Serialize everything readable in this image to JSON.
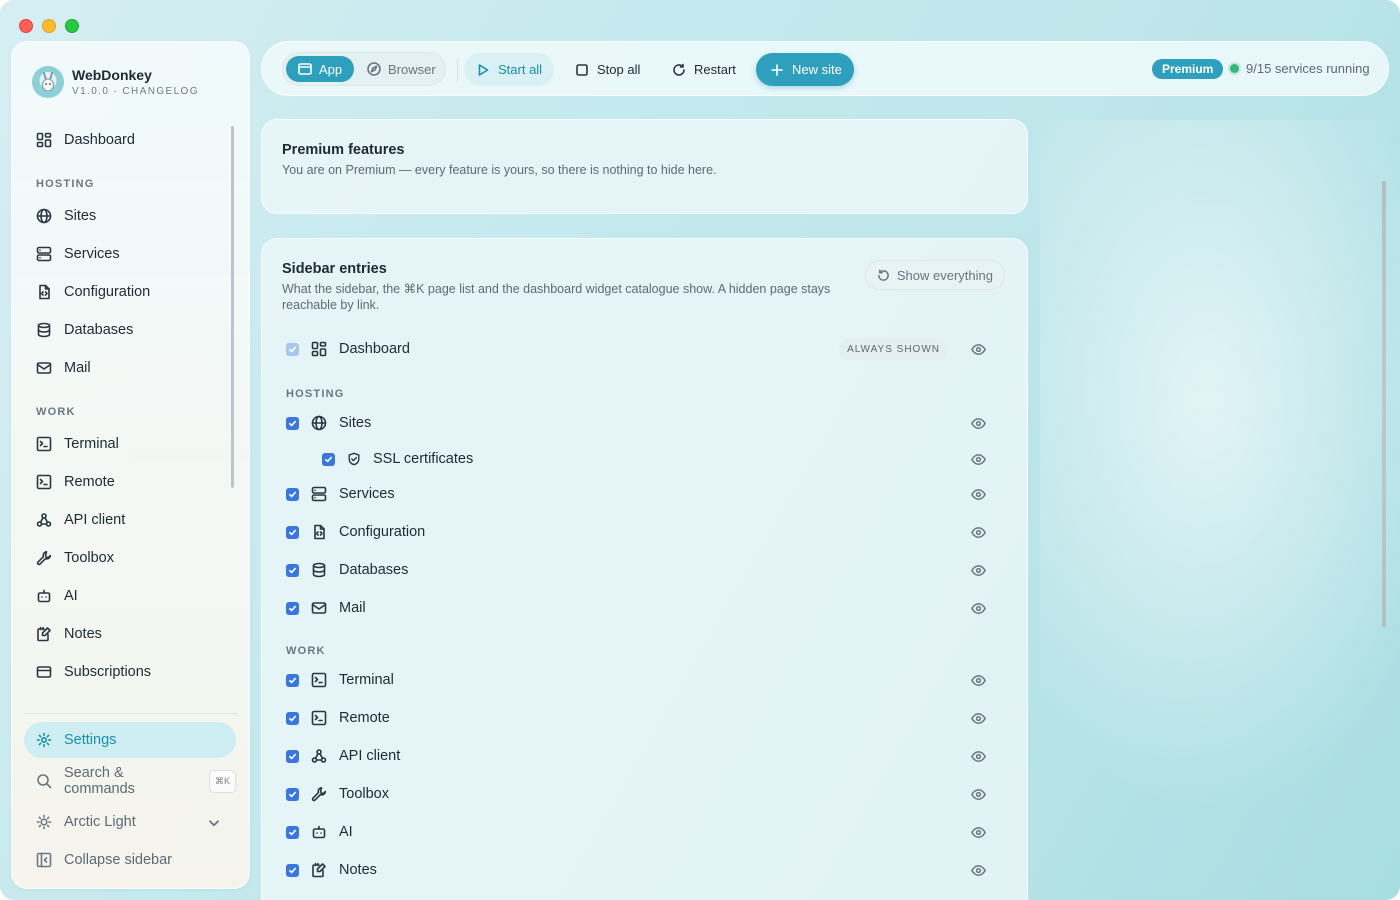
{
  "window": {
    "traffic_lights": [
      "close",
      "minimize",
      "zoom"
    ]
  },
  "brand": {
    "name": "WebDonkey",
    "subtitle": "V1.0.0 · CHANGELOG",
    "avatar_icon": "donkey-avatar-icon"
  },
  "sidebar": {
    "dashboard": {
      "label": "Dashboard",
      "icon": "dashboard-icon"
    },
    "sections": [
      {
        "label": "HOSTING",
        "items": [
          {
            "label": "Sites",
            "icon": "globe-icon"
          },
          {
            "label": "Services",
            "icon": "server-icon"
          },
          {
            "label": "Configuration",
            "icon": "config-file-icon"
          },
          {
            "label": "Databases",
            "icon": "database-icon"
          },
          {
            "label": "Mail",
            "icon": "mail-icon"
          }
        ]
      },
      {
        "label": "WORK",
        "items": [
          {
            "label": "Terminal",
            "icon": "terminal-icon"
          },
          {
            "label": "Remote",
            "icon": "remote-terminal-icon"
          },
          {
            "label": "API client",
            "icon": "webhook-icon"
          },
          {
            "label": "Toolbox",
            "icon": "wrench-icon"
          },
          {
            "label": "AI",
            "icon": "bot-icon"
          },
          {
            "label": "Notes",
            "icon": "notes-icon"
          },
          {
            "label": "Subscriptions",
            "icon": "card-icon"
          }
        ]
      }
    ],
    "footer": {
      "settings": {
        "label": "Settings",
        "icon": "gear-icon",
        "active": true
      },
      "search": {
        "label": "Search & commands",
        "shortcut": "⌘K",
        "icon": "search-icon"
      },
      "theme": {
        "label": "Arctic Light",
        "icon": "sun-icon"
      },
      "collapse": {
        "label": "Collapse sidebar",
        "icon": "sidebar-collapse-icon"
      }
    }
  },
  "toolbar": {
    "mode": {
      "app": "App",
      "browser": "Browser",
      "selected": "App"
    },
    "start_all": "Start all",
    "stop_all": "Stop all",
    "restart": "Restart",
    "new_site": "New site",
    "plan_badge": "Premium",
    "services_status": "9/15 services running"
  },
  "premium_card": {
    "title": "Premium features",
    "description": "You are on Premium — every feature is yours, so there is nothing to hide here."
  },
  "entries_card": {
    "title": "Sidebar entries",
    "description_line1": "What the sidebar, the ⌘K page list and the dashboard widget catalogue show. A hidden page stays",
    "description_line2": "reachable by link.",
    "show_everything": "Show everything",
    "always_shown": "ALWAYS SHOWN",
    "dashboard": {
      "label": "Dashboard",
      "checked": true,
      "locked": true
    },
    "groups": [
      {
        "label": "HOSTING",
        "entries": [
          {
            "label": "Sites",
            "checked": true
          },
          {
            "label": "SSL certificates",
            "checked": true,
            "child": true
          },
          {
            "label": "Services",
            "checked": true
          },
          {
            "label": "Configuration",
            "checked": true
          },
          {
            "label": "Databases",
            "checked": true
          },
          {
            "label": "Mail",
            "checked": true
          }
        ]
      },
      {
        "label": "WORK",
        "entries": [
          {
            "label": "Terminal",
            "checked": true
          },
          {
            "label": "Remote",
            "checked": true
          },
          {
            "label": "API client",
            "checked": true
          },
          {
            "label": "Toolbox",
            "checked": true
          },
          {
            "label": "AI",
            "checked": true
          },
          {
            "label": "Notes",
            "checked": true
          }
        ]
      }
    ]
  },
  "colors": {
    "accent": "#2e9fbc",
    "checkbox": "#3a77dc",
    "status_ok": "#35b87a"
  }
}
